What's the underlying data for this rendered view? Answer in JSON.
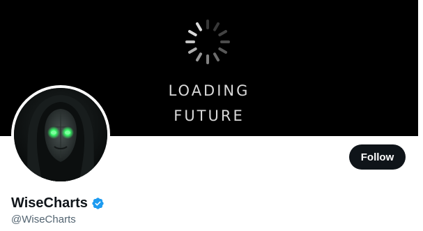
{
  "banner": {
    "line1": "LOADING",
    "line2": "FUTURE"
  },
  "profile": {
    "display_name": "WiseCharts",
    "handle": "@WiseCharts",
    "verified_icon": "verified-badge-icon"
  },
  "actions": {
    "follow_label": "Follow"
  },
  "colors": {
    "banner_bg": "#000000",
    "button_bg": "#0f1419",
    "verified": "#1d9bf0",
    "handle_text": "#536471",
    "avatar_eyes": "#39ff6a"
  }
}
